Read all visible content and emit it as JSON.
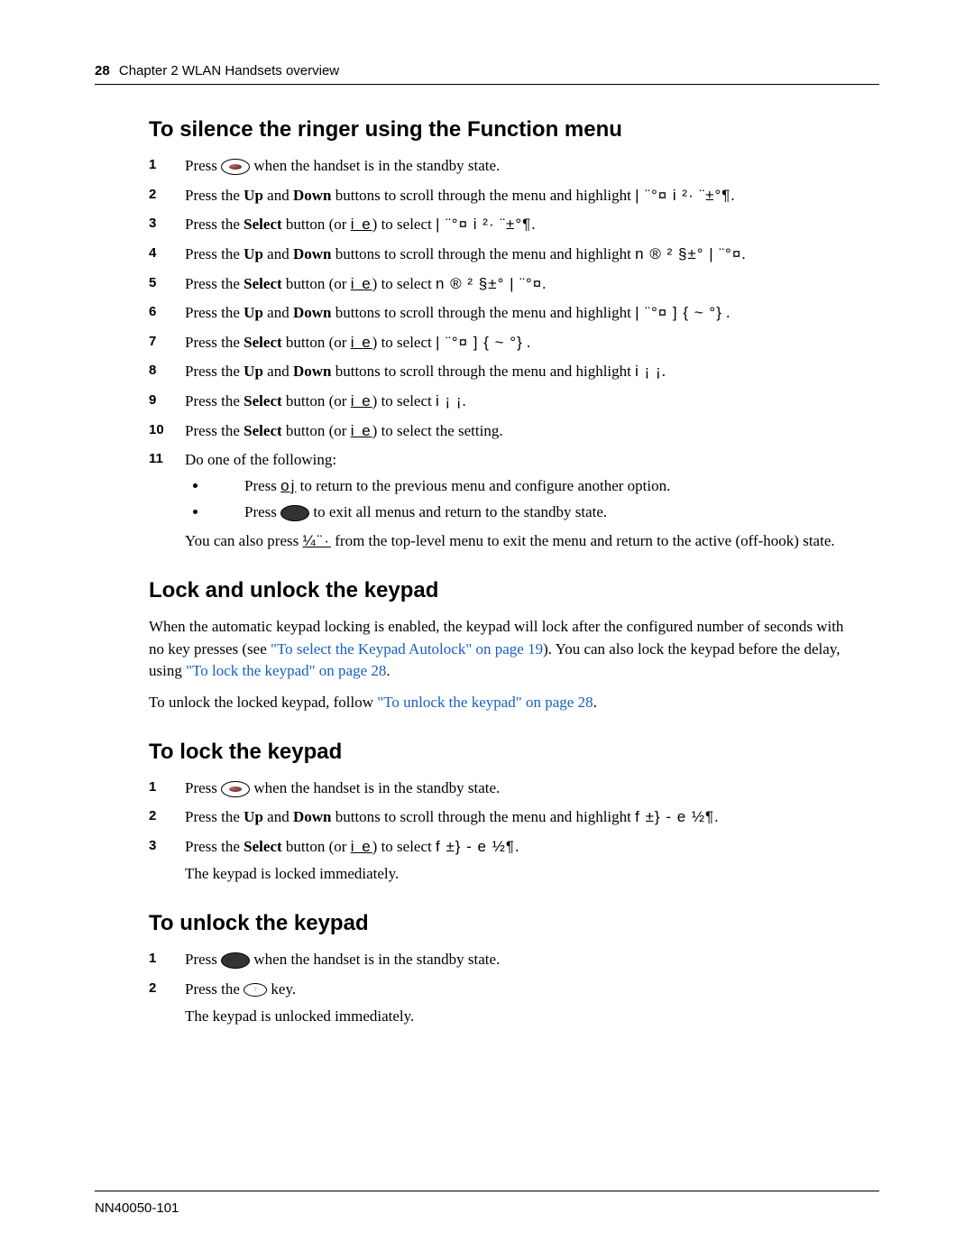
{
  "header": {
    "page_number": "28",
    "chapter_line": "Chapter 2  WLAN Handsets overview"
  },
  "sections": {
    "silence": {
      "title": "To silence the ringer using the Function menu",
      "steps": {
        "s1": "when the handset is in the standby state.",
        "s2a": "Press the ",
        "s2b": "Up",
        "s2c": " and ",
        "s2d": "Down",
        "s2e": " buttons to scroll through the menu and highlight ",
        "s2m": "| ¨°¤ i ²· ¨±°¶",
        "s3a": "Press the ",
        "s3b": "Select",
        "s3c": " button (or ",
        "s3d": "i e",
        "s3e": ") to select ",
        "s3m": "| ¨°¤ i ²· ¨±°¶",
        "s4a": "Press the ",
        "s4b": "Up",
        "s4c": " and ",
        "s4d": "Down",
        "s4e": " buttons to scroll through the menu and highlight ",
        "s4m": "n ® ² §±°  | ¨°¤",
        "s5a": "Press the ",
        "s5b": "Select",
        "s5c": " button (or ",
        "s5d": "i e",
        "s5e": ") to select ",
        "s5m": "n ® ² §±°  | ¨°¤",
        "s6a": "Press the ",
        "s6b": "Up",
        "s6c": " and ",
        "s6d": "Down",
        "s6e": " buttons to scroll through the menu and highlight ",
        "s6m": "| ¨°¤ ] { ~ °}",
        "s7a": "Press the ",
        "s7b": "Select",
        "s7c": " button (or ",
        "s7d": "i e",
        "s7e": ") to select ",
        "s7m": "| ¨°¤ ] { ~ °}",
        "s8a": "Press the ",
        "s8b": "Up",
        "s8c": " and ",
        "s8d": "Down",
        "s8e": " buttons to scroll through the menu and highlight ",
        "s8m": "i ¡ ¡",
        "s9a": "Press the ",
        "s9b": "Select",
        "s9c": " button (or ",
        "s9d": "i e",
        "s9e": ") to select ",
        "s9m": "i ¡ ¡",
        "s10a": "Press the ",
        "s10b": "Select",
        "s10c": " button (or ",
        "s10d": "i e",
        "s10e": ") to select the setting.",
        "s11": "Do one of the following:",
        "s11b1a": "Press ",
        "s11b1k": "oj",
        "s11b1b": " to return to the previous menu and configure another option.",
        "s11b2a": "Press ",
        "s11b2b": " to exit all menus and return to the standby state.",
        "note_a": "You can also press ",
        "note_key": " ¼¨·",
        "note_b": " from the top-level menu to exit the menu and return to the active (off-hook) state."
      }
    },
    "lockunlock": {
      "title": "Lock and unlock the keypad",
      "p1a": "When the automatic keypad locking is enabled, the keypad will lock after the configured number of seconds with no key presses (see ",
      "link1": "\"To select the Keypad Autolock\" on page 19",
      "p1b": "). You can also lock the keypad before the delay, using ",
      "link2": "\"To lock the keypad\" on page 28",
      "p1c": ".",
      "p2a": "To unlock the locked keypad, follow ",
      "link3": "\"To unlock the keypad\" on page 28",
      "p2b": "."
    },
    "lock": {
      "title": "To lock the keypad",
      "s1": "when the handset is in the standby state.",
      "s2a": "Press the ",
      "s2b": "Up",
      "s2c": " and ",
      "s2d": "Down",
      "s2e": " buttons to scroll through the menu and highlight ",
      "s2m": "f ±} - e ½¶",
      "s3a": "Press the ",
      "s3b": "Select",
      "s3c": " button (or ",
      "s3d": "i e",
      "s3e": ") to select ",
      "s3m": "f ±} - e ½¶",
      "s3_post": "The keypad is locked immediately."
    },
    "unlock": {
      "title": "To unlock the keypad",
      "s1": "when the handset is in the standby state.",
      "s2a": "Press the ",
      "s2b": " key.",
      "s2_post": "The keypad is unlocked immediately."
    }
  },
  "footer": {
    "doc_id": "NN40050-101"
  },
  "labels": {
    "press": "Press "
  },
  "nums": [
    "1",
    "2",
    "3",
    "4",
    "5",
    "6",
    "7",
    "8",
    "9",
    "10",
    "11"
  ]
}
